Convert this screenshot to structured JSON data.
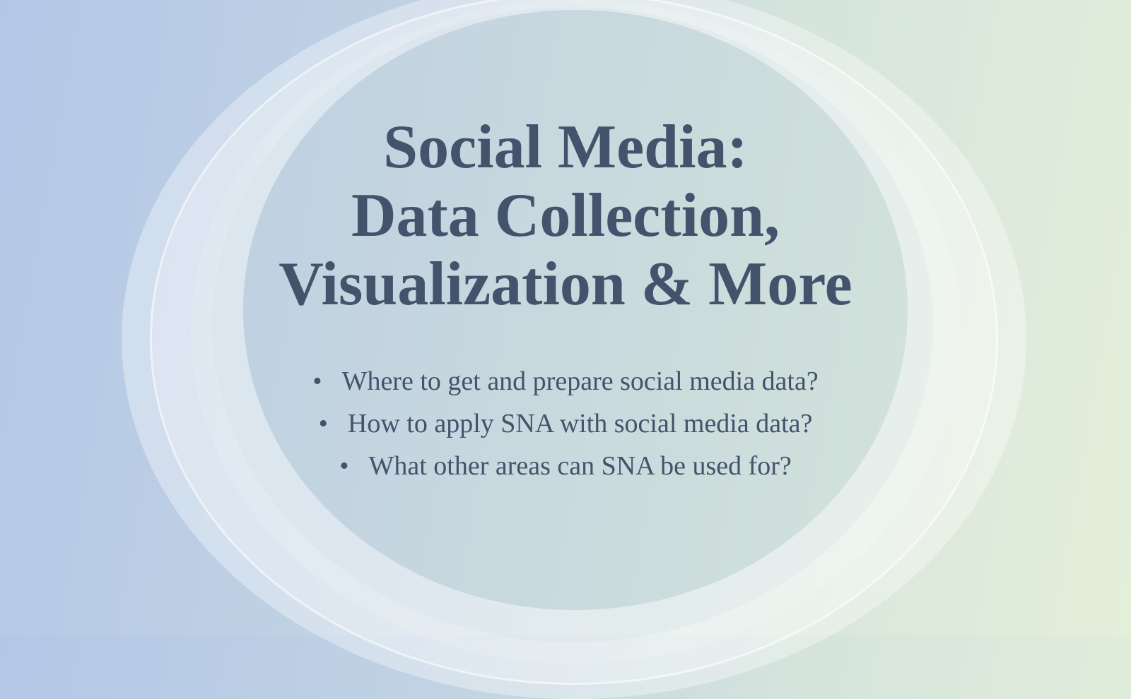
{
  "slide": {
    "title_lines": [
      "Social Media:",
      "Data Collection,",
      "Visualization & More"
    ],
    "bullets": [
      "Where to get and prepare social media data?",
      "How to apply SNA with social media data?",
      "What other areas can SNA be used for?"
    ],
    "bullet_symbol": "•",
    "colors": {
      "text": "#43536c",
      "bg_left": "#b3c7e7",
      "bg_right": "#e4efda"
    }
  }
}
